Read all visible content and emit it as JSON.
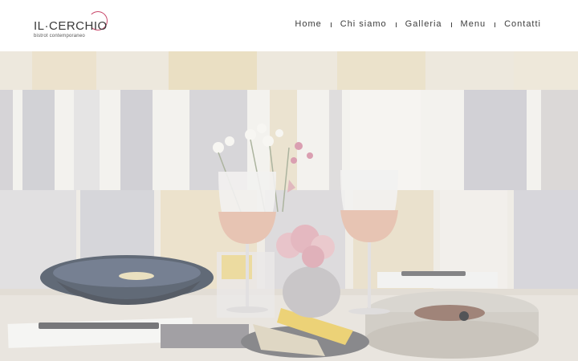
{
  "brand": {
    "name": "IL·CERCHIO",
    "tagline": "bistrot contemporaneo",
    "accent": "#c9486b"
  },
  "nav": {
    "items": [
      {
        "label": "Home"
      },
      {
        "label": "Chi siamo"
      },
      {
        "label": "Galleria"
      },
      {
        "label": "Menu"
      },
      {
        "label": "Contatti"
      }
    ]
  },
  "hero": {
    "image": "restaurant-table-photo"
  }
}
